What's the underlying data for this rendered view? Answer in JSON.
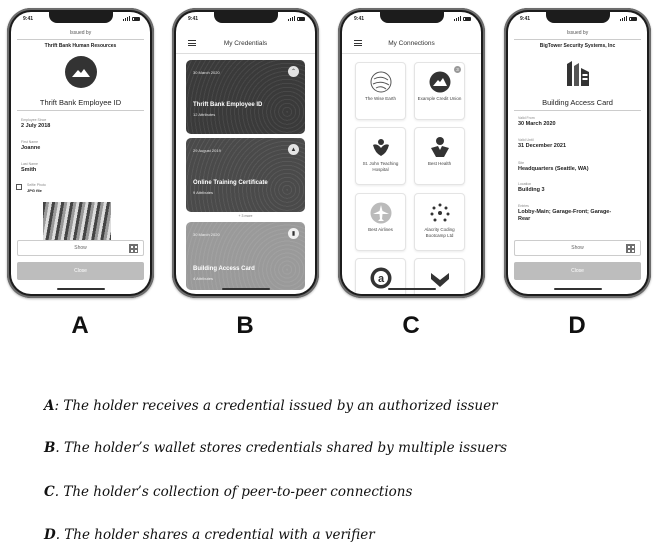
{
  "status_time": "9:41",
  "phone_a": {
    "issued_by_label": "Issued by",
    "issuer": "Thrift Bank Human Resources",
    "title": "Thrift Bank Employee ID",
    "attributes": [
      {
        "label": "Employee Since",
        "value": "2 July 2018"
      },
      {
        "label": "First Name",
        "value": "Joanne"
      },
      {
        "label": "Last Name",
        "value": "Smith"
      }
    ],
    "photo_label": "Selfie Photo",
    "photo_value": "JPG file",
    "show_label": "Show",
    "close_label": "Close"
  },
  "phone_b": {
    "title": "My Credentials",
    "cards": [
      {
        "date": "30 March 2020",
        "name": "Thrift Bank Employee ID",
        "attrs": "12 Attributes"
      },
      {
        "date": "29 August 2019",
        "name": "Online Training Certificate",
        "attrs": "9 Attributes"
      },
      {
        "date": "30 March 2020",
        "name": "Building Access Card",
        "attrs": "4 Attributes"
      }
    ],
    "more_label": "+ 3 more"
  },
  "phone_c": {
    "title": "My Connections",
    "tiles": [
      {
        "name": "The Wise Earth",
        "icon": "globe-icon"
      },
      {
        "name": "Example Credit Union",
        "icon": "mountain-icon",
        "badge": "3"
      },
      {
        "name": "St. John Teaching Hospital",
        "icon": "hospital-icon"
      },
      {
        "name": "Best Health",
        "icon": "person-icon"
      },
      {
        "name": "Best Airlines",
        "icon": "airplane-icon"
      },
      {
        "name": "Alacrity Coding Bootcamp Ltd",
        "icon": "dots-icon"
      },
      {
        "name": "",
        "icon": "a-logo-icon"
      },
      {
        "name": "",
        "icon": "heart-icon"
      }
    ]
  },
  "phone_d": {
    "issued_by_label": "Issued by",
    "issuer": "BigTower Security Systems, Inc",
    "title": "Building Access Card",
    "attributes": [
      {
        "label": "Valid From",
        "value": "30 March 2020"
      },
      {
        "label": "Valid Until",
        "value": "31 December 2021"
      },
      {
        "label": "Site",
        "value": "Headquarters (Seattle, WA)"
      },
      {
        "label": "Location",
        "value": "Building 3"
      },
      {
        "label": "Entries",
        "value": "Lobby-Main; Garage-Front; Garage-Rear"
      }
    ],
    "show_label": "Show",
    "close_label": "Close"
  },
  "letters": [
    "A",
    "B",
    "C",
    "D"
  ],
  "captions": [
    {
      "letter": "A",
      "text": ": The holder receives a credential issued by an authorized issuer"
    },
    {
      "letter": "B",
      "text": ". The holder’s wallet stores credentials shared by multiple issuers"
    },
    {
      "letter": "C",
      "text": ". The holder’s collection of peer-to-peer connections"
    },
    {
      "letter": "D",
      "text": ". The holder shares a credential with a verifier"
    }
  ]
}
